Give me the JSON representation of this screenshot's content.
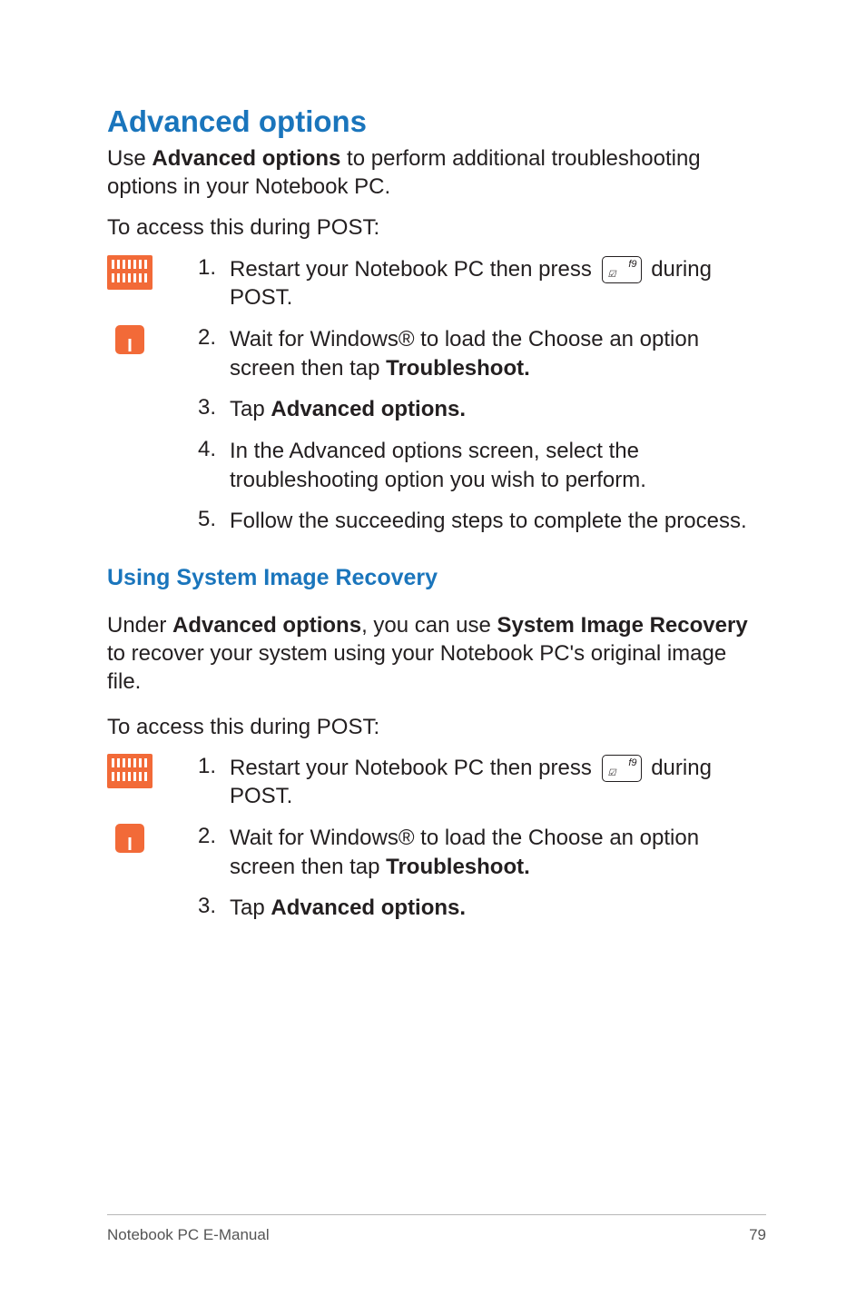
{
  "heading": "Advanced options",
  "intro": {
    "pre": "Use ",
    "bold": "Advanced options",
    "post": " to perform additional troubleshooting options in your Notebook PC."
  },
  "access_line": "To access this during POST:",
  "steps_a": {
    "s1n": "1.",
    "s1_pre": "Restart your Notebook PC then press ",
    "s1_post": " during POST.",
    "s2n": "2.",
    "s2_pre": "Wait for Windows® to load the Choose an option screen then tap ",
    "s2_bold": "Troubleshoot.",
    "s3n": "3.",
    "s3_pre": "Tap ",
    "s3_bold": "Advanced options.",
    "s4n": "4.",
    "s4_text": "In the Advanced options screen, select the troubleshooting option you wish to perform.",
    "s5n": "5.",
    "s5_text": "Follow the succeeding steps to complete the process."
  },
  "sub_heading": "Using System Image Recovery",
  "sub_intro": {
    "p1": "Under ",
    "b1": "Advanced options",
    "p2": ", you can use ",
    "b2": "System Image Recovery",
    "p3": " to recover your system using your Notebook PC's original image file."
  },
  "access_line_2": "To access this during POST:",
  "steps_b": {
    "s1n": "1.",
    "s1_pre": "Restart your Notebook PC then press ",
    "s1_post": " during POST.",
    "s2n": "2.",
    "s2_pre": "Wait for Windows® to load the Choose an option screen then tap ",
    "s2_bold": "Troubleshoot.",
    "s3n": "3.",
    "s3_pre": "Tap ",
    "s3_bold": "Advanced options."
  },
  "footer": {
    "title": "Notebook PC E-Manual",
    "page": "79"
  }
}
